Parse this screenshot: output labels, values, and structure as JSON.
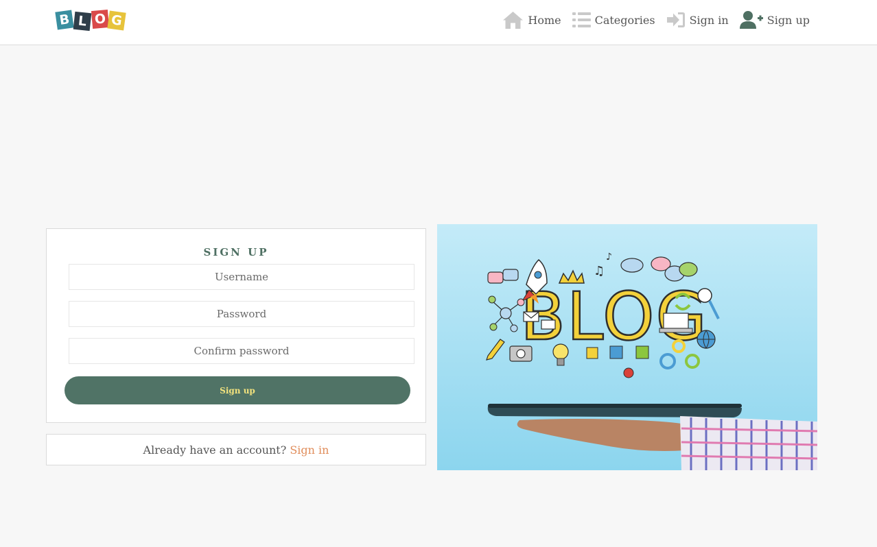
{
  "logo": {
    "letters": [
      "B",
      "L",
      "O",
      "G"
    ]
  },
  "nav": {
    "items": [
      {
        "label": "Home",
        "icon": "home-icon"
      },
      {
        "label": "Categories",
        "icon": "list-icon"
      },
      {
        "label": "Sign in",
        "icon": "sign-in-icon"
      },
      {
        "label": "Sign up",
        "icon": "user-plus-icon"
      }
    ]
  },
  "signup": {
    "title": "SIGN UP",
    "username_placeholder": "Username",
    "password_placeholder": "Password",
    "confirm_placeholder": "Confirm password",
    "button_label": "Sign up"
  },
  "signin_prompt": {
    "text": "Already have an account?",
    "link": "Sign in"
  },
  "hero": {
    "word": "BLOG"
  },
  "colors": {
    "accent": "#507366",
    "button_text": "#f2e27d",
    "link": "#e08c5a",
    "background": "#f7f7f7"
  }
}
